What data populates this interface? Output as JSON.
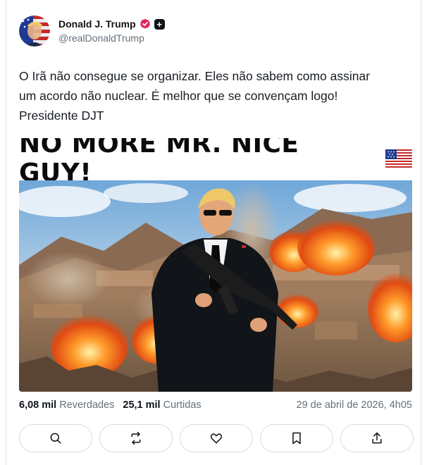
{
  "author": {
    "display_name": "Donald J. Trump",
    "handle": "@realDonaldTrump",
    "verified_badge_color": "#e0245e",
    "plus_badge": "+"
  },
  "post": {
    "line1": "O Irã não consegue se organizar. Eles não sabem como assinar",
    "line2": "um acordo não nuclear. É melhor que se convençam logo!",
    "line3": "Presidente DJT"
  },
  "media": {
    "headline": "NO MORE MR. NICE GUY!",
    "headline_emoji": "🇺🇸"
  },
  "stats": {
    "reposts_count": "6,08 mil",
    "reposts_label": "Reverdades",
    "likes_count": "25,1 mil",
    "likes_label": "Curtidas",
    "timestamp": "29 de abril de 2026, 4h05"
  },
  "actions": [
    {
      "icon": "reply-icon"
    },
    {
      "icon": "repost-icon"
    },
    {
      "icon": "like-icon"
    },
    {
      "icon": "bookmark-icon"
    },
    {
      "icon": "share-icon"
    }
  ],
  "colors": {
    "text": "#0f1419",
    "muted": "#66707a",
    "border": "#d6dbe0"
  }
}
